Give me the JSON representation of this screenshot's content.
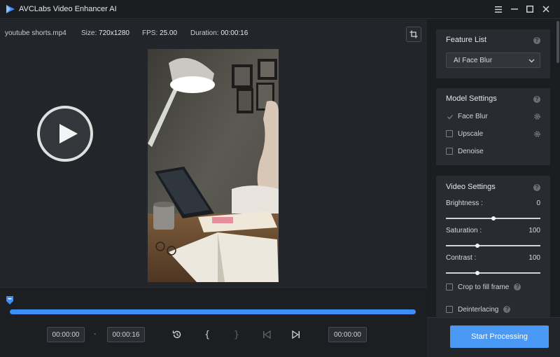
{
  "app": {
    "title": "AVCLabs Video Enhancer AI"
  },
  "info": {
    "filename": "youtube shorts.mp4",
    "size_label": "Size:",
    "size_value": "720x1280",
    "fps_label": "FPS:",
    "fps_value": "25.00",
    "duration_label": "Duration:",
    "duration_value": "00:00:16"
  },
  "timeline": {
    "start_time": "00:00:00",
    "separator": "-",
    "end_time": "00:00:16",
    "current_time": "00:00:00",
    "progress_fraction": 1.0
  },
  "feature_list": {
    "title": "Feature List",
    "selected": "AI Face Blur"
  },
  "model_settings": {
    "title": "Model Settings",
    "options": [
      {
        "label": "Face Blur",
        "checked": true
      },
      {
        "label": "Upscale",
        "checked": false
      },
      {
        "label": "Denoise",
        "checked": false
      }
    ]
  },
  "video_settings": {
    "title": "Video Settings",
    "sliders": [
      {
        "label": "Brightness :",
        "value": "0",
        "fraction": 0.5
      },
      {
        "label": "Saturation :",
        "value": "100",
        "fraction": 0.33
      },
      {
        "label": "Contrast :",
        "value": "100",
        "fraction": 0.33
      }
    ],
    "options": [
      {
        "label": "Crop to fill frame",
        "checked": false
      },
      {
        "label": "Deinterlacing",
        "checked": false
      }
    ]
  },
  "actions": {
    "start": "Start Processing"
  },
  "colors": {
    "accent": "#3d8ef5",
    "button": "#4a99f5"
  }
}
